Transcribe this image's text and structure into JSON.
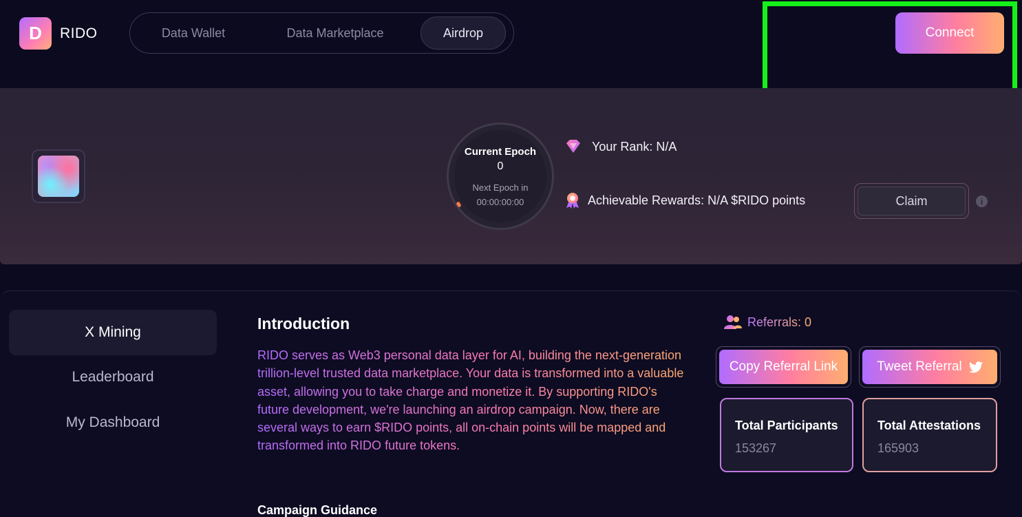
{
  "header": {
    "logo_text": "RIDO",
    "logo_glyph": "D",
    "nav_tabs": [
      {
        "label": "Data Wallet",
        "active": false
      },
      {
        "label": "Data Marketplace",
        "active": false
      },
      {
        "label": "Airdrop",
        "active": true
      }
    ],
    "connect_label": "Connect"
  },
  "epoch": {
    "title": "Current Epoch",
    "number": "0",
    "next_label": "Next Epoch in",
    "countdown": "00:00:00:00"
  },
  "rank": {
    "text": "Your Rank: N/A"
  },
  "rewards": {
    "text": "Achievable Rewards: N/A $RIDO points"
  },
  "claim_label": "Claim",
  "sidebar": {
    "items": [
      {
        "label": "X Mining",
        "active": true
      },
      {
        "label": "Leaderboard",
        "active": false
      },
      {
        "label": "My Dashboard",
        "active": false
      }
    ]
  },
  "intro": {
    "title": "Introduction",
    "body": "RIDO serves as Web3 personal data layer for AI, building the next-generation trillion-level trusted data marketplace. Your data is transformed into a valuable asset, allowing you to take charge and monetize it. By supporting RIDO's future development, we're launching an airdrop campaign. Now, there are several ways to earn $RIDO points, all on-chain points will be mapped and transformed into RIDO future tokens.",
    "guidance_title": "Campaign Guidance"
  },
  "referrals": {
    "text": "Referrals: 0",
    "copy_label": "Copy Referral Link",
    "tweet_label": "Tweet Referral"
  },
  "stats": [
    {
      "label": "Total Participants",
      "value": "153267"
    },
    {
      "label": "Total Attestations",
      "value": "165903"
    }
  ],
  "colors": {
    "background": "#0b0a1f",
    "accent_start": "#b06cff",
    "accent_mid": "#ff7ea0",
    "accent_end": "#ffae70",
    "highlight": "#16f01a"
  }
}
